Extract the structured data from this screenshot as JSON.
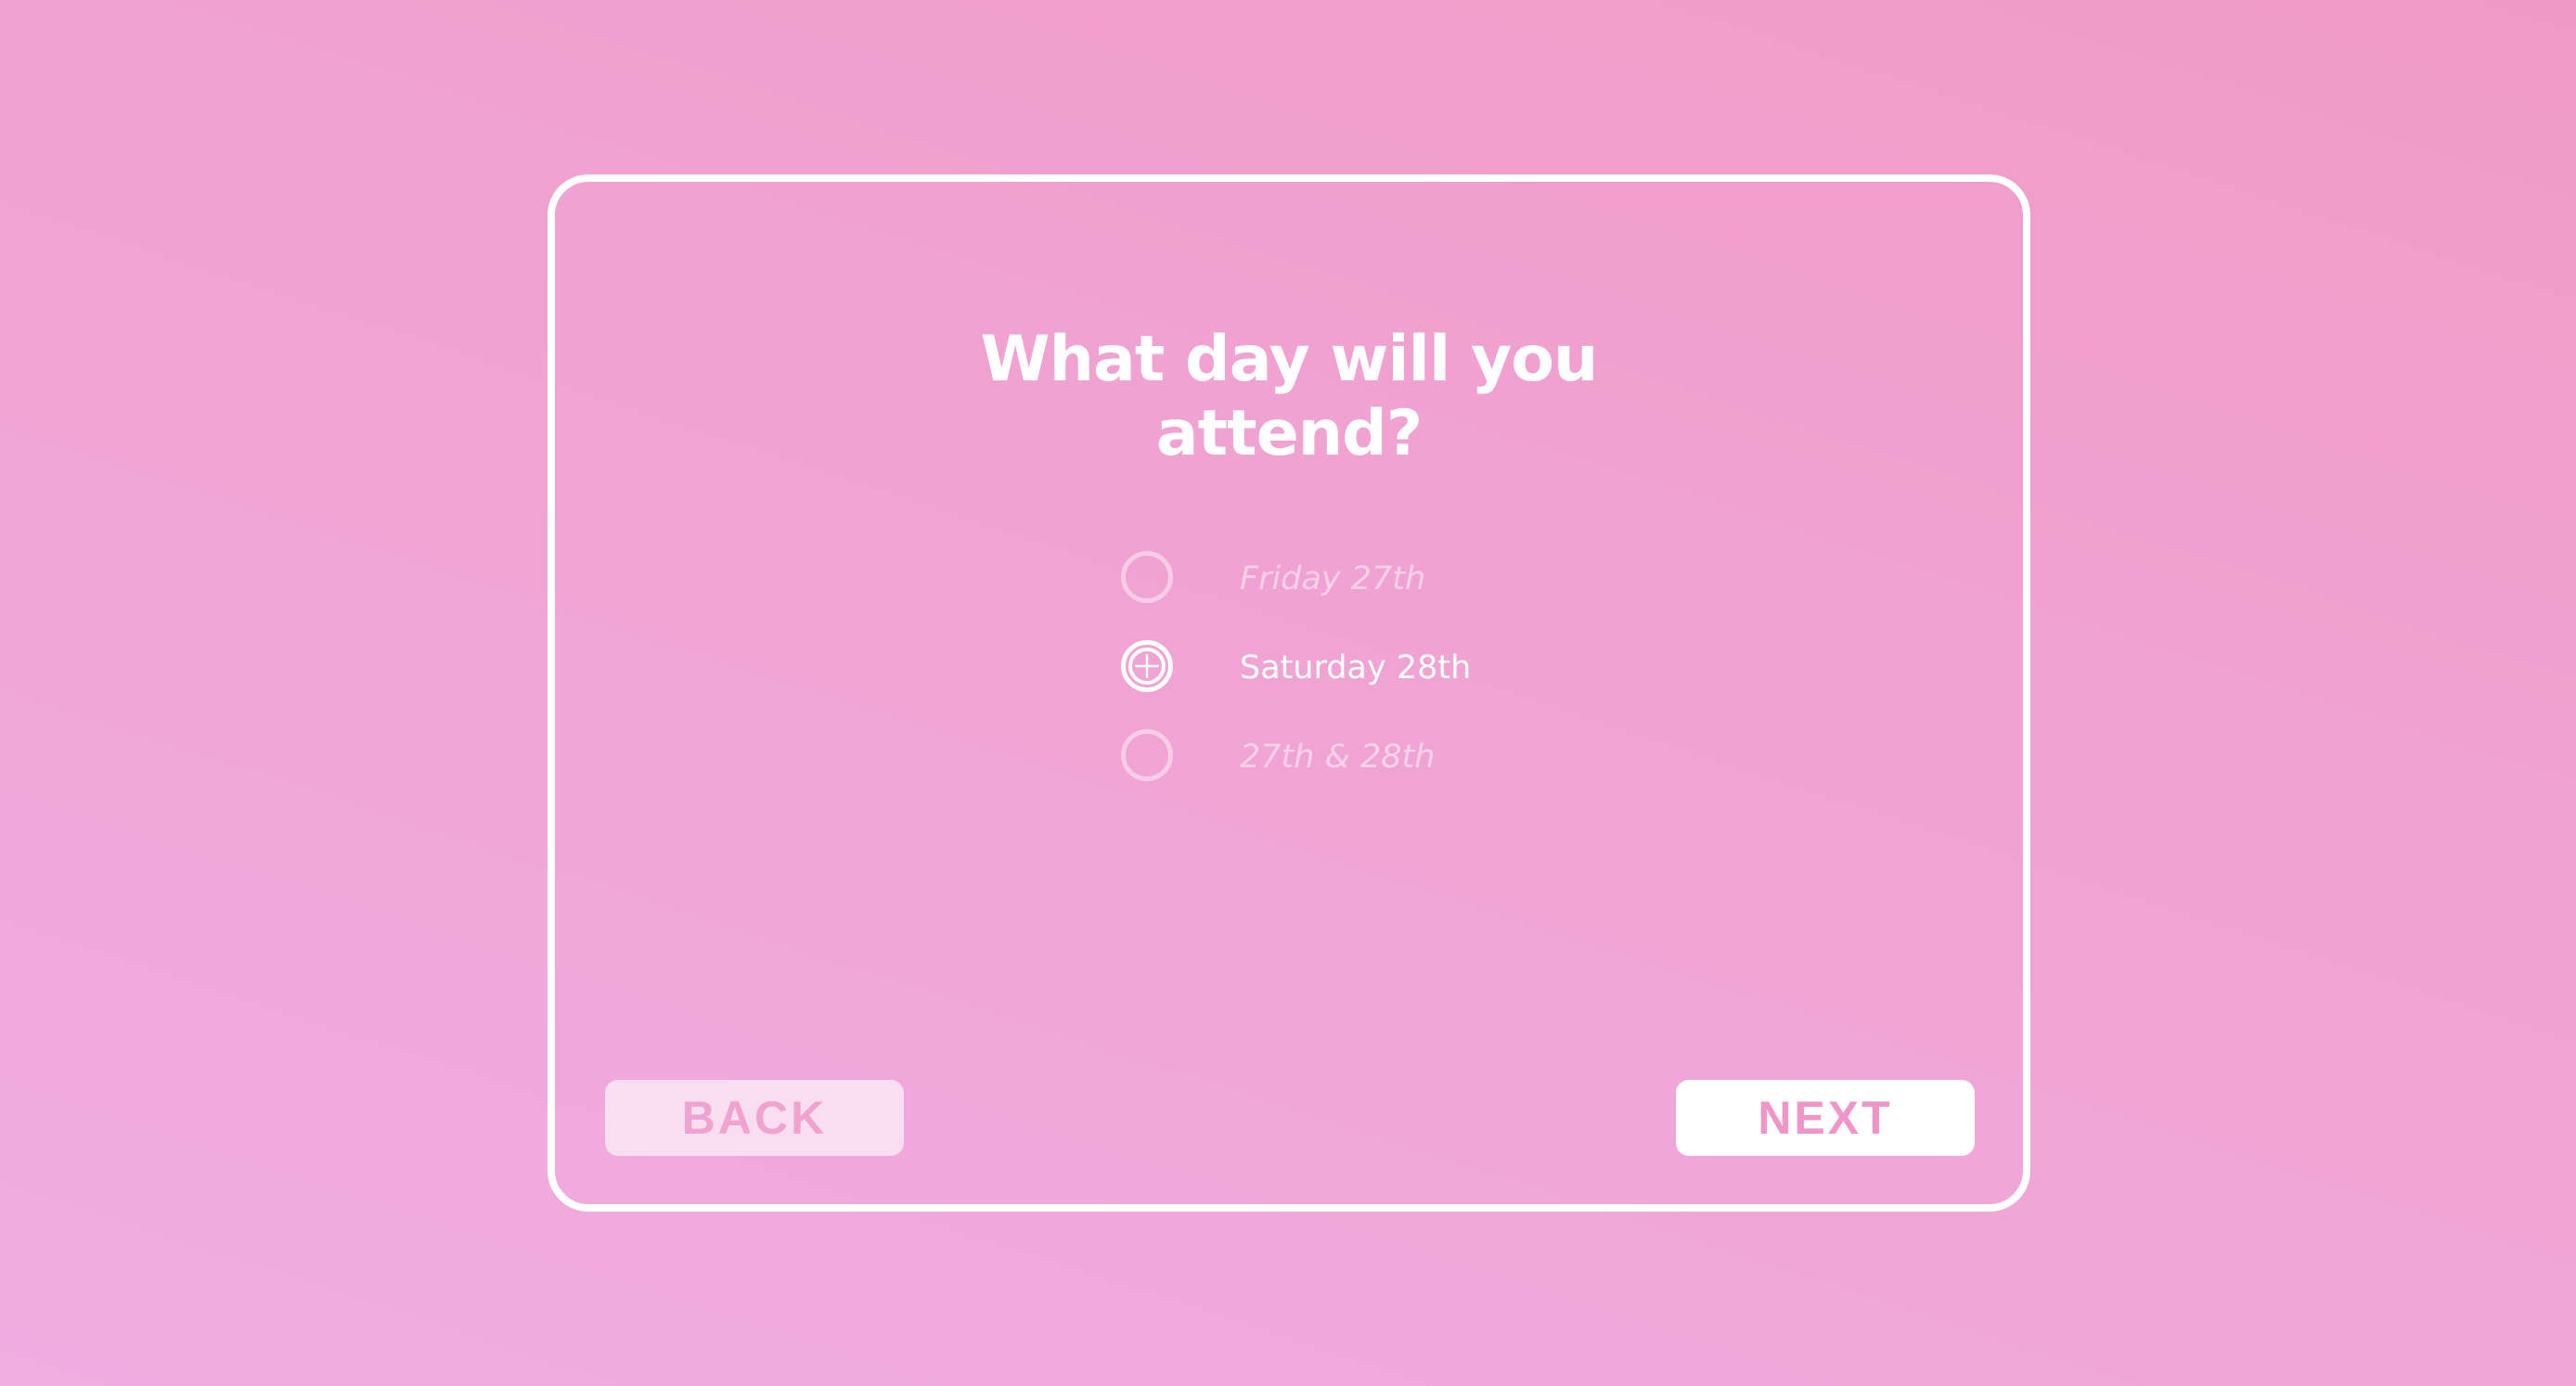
{
  "question": {
    "line1": "What day will you",
    "line2": "attend?"
  },
  "options": [
    {
      "label": "Friday 27th",
      "selected": false
    },
    {
      "label": "Saturday 28th",
      "selected": true
    },
    {
      "label": "27th & 28th",
      "selected": false
    }
  ],
  "buttons": {
    "back_label": "BACK",
    "next_label": "NEXT"
  },
  "colors": {
    "background_start": "#f0ade0",
    "background_end": "#f09bc6",
    "accent": "#ffffff",
    "button_text": "#f095c8"
  },
  "icons": {
    "selected_marker": "plus-in-circle-icon",
    "unselected_marker": "empty-circle-icon"
  }
}
